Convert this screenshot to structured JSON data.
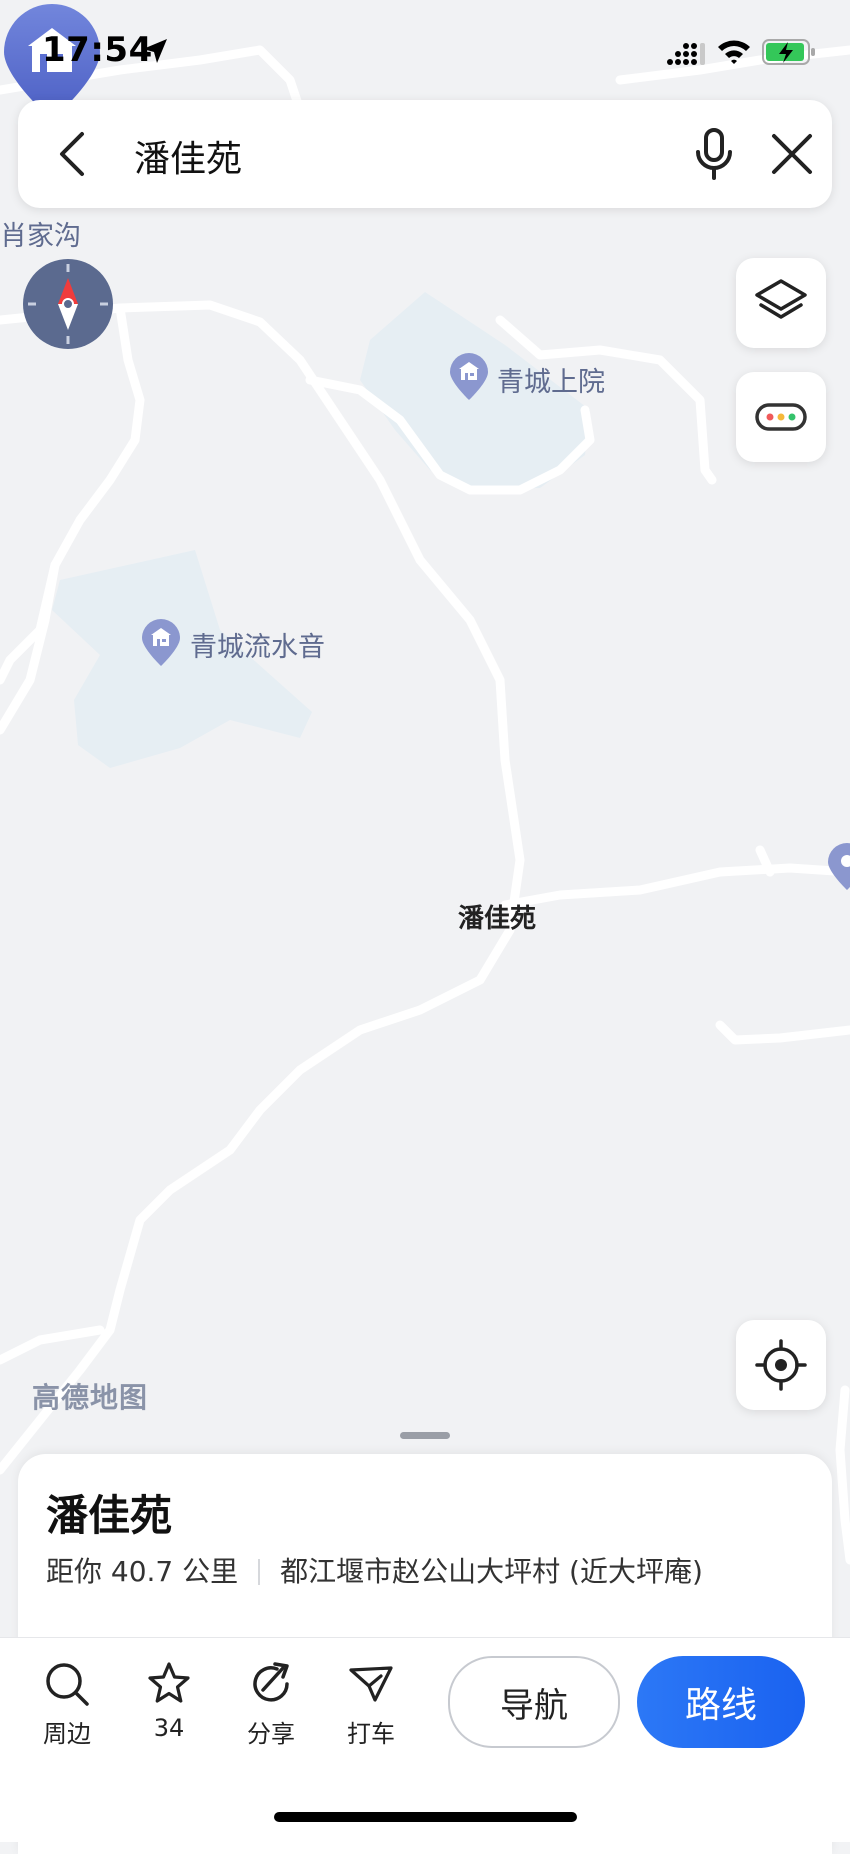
{
  "status_bar": {
    "time": "17:54"
  },
  "search": {
    "query": "潘佳苑"
  },
  "map": {
    "labels": {
      "village": "肖家沟",
      "poi_1": "青城上院",
      "poi_2": "青城流水音",
      "main_pin": "潘佳苑",
      "logo": "高德地图"
    }
  },
  "place": {
    "name": "潘佳苑",
    "distance": "距你 40.7 公里",
    "address": "都江堰市赵公山大坪村 (近大坪庵)"
  },
  "toolbar": {
    "nearby": "周边",
    "favorites_count": "34",
    "share": "分享",
    "taxi": "打车",
    "navigate": "导航",
    "route": "路线"
  },
  "colors": {
    "accent": "#1a62f0",
    "pin": "#5b6fd0",
    "label": "#5f6b8f"
  }
}
